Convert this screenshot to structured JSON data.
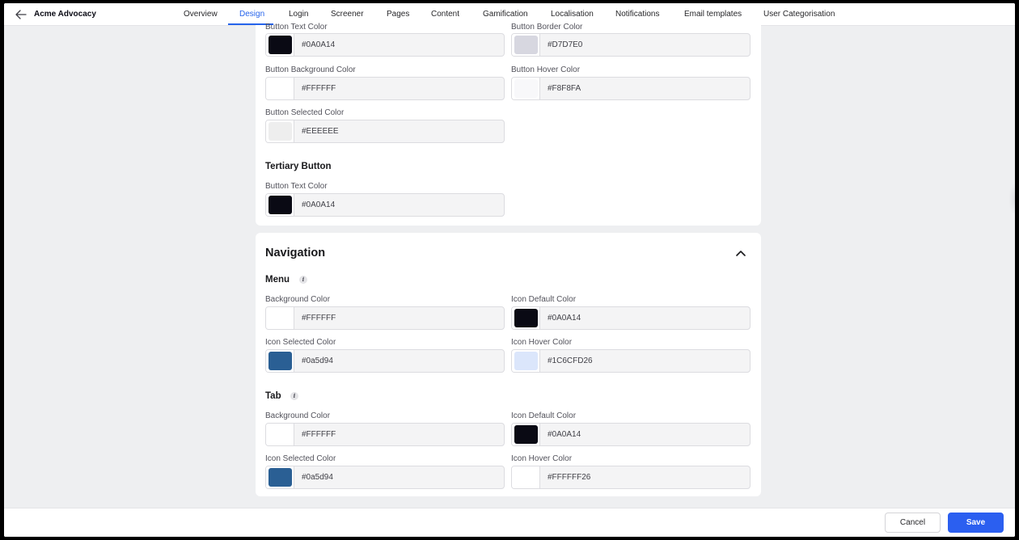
{
  "app": {
    "title": "Acme Advocacy"
  },
  "nav": {
    "tabs": [
      {
        "label": "Overview"
      },
      {
        "label": "Design"
      },
      {
        "label": "Login"
      },
      {
        "label": "Screener"
      },
      {
        "label": "Pages"
      },
      {
        "label": "Content"
      },
      {
        "label": "Gamification"
      },
      {
        "label": "Localisation"
      },
      {
        "label": "Notifications"
      },
      {
        "label": "Email templates"
      },
      {
        "label": "User Categorisation"
      }
    ],
    "active_tab": "Design"
  },
  "buttons_card": {
    "secondary": {
      "text_color": {
        "label": "Button Text Color",
        "value": "#0A0A14",
        "swatch": "#0a0a14"
      },
      "border_color": {
        "label": "Button Border Color",
        "value": "#D7D7E0",
        "swatch": "#d7d7e0"
      },
      "background_color": {
        "label": "Button Background Color",
        "value": "#FFFFFF",
        "swatch": "#ffffff"
      },
      "hover_color": {
        "label": "Button Hover Color",
        "value": "#F8F8FA",
        "swatch": "#f8f8fa"
      },
      "selected_color": {
        "label": "Button Selected Color",
        "value": "#EEEEEE",
        "swatch": "#eeeeee"
      }
    },
    "tertiary": {
      "heading": "Tertiary Button",
      "text_color": {
        "label": "Button Text Color",
        "value": "#0A0A14",
        "swatch": "#0a0a14"
      }
    }
  },
  "navigation_card": {
    "title": "Navigation",
    "menu": {
      "heading": "Menu",
      "background_color": {
        "label": "Background Color",
        "value": "#FFFFFF",
        "swatch": "#ffffff"
      },
      "icon_default_color": {
        "label": "Icon Default Color",
        "value": "#0A0A14",
        "swatch": "#0a0a14"
      },
      "icon_selected_color": {
        "label": "Icon Selected Color",
        "value": "#0a5d94",
        "swatch": "#2a5f94"
      },
      "icon_hover_color": {
        "label": "Icon Hover Color",
        "value": "#1C6CFD26",
        "swatch": "#dbe6fb"
      }
    },
    "tab": {
      "heading": "Tab",
      "background_color": {
        "label": "Background Color",
        "value": "#FFFFFF",
        "swatch": "#ffffff"
      },
      "icon_default_color": {
        "label": "Icon Default Color",
        "value": "#0A0A14",
        "swatch": "#0a0a14"
      },
      "icon_selected_color": {
        "label": "Icon Selected Color",
        "value": "#0a5d94",
        "swatch": "#2a5f94"
      },
      "icon_hover_color": {
        "label": "Icon Hover Color",
        "value": "#FFFFFF26",
        "swatch": "#ffffff"
      }
    }
  },
  "footer": {
    "cancel_label": "Cancel",
    "save_label": "Save"
  },
  "colors": {
    "accent": "#2563eb",
    "save_button": "#2b5ff0"
  }
}
